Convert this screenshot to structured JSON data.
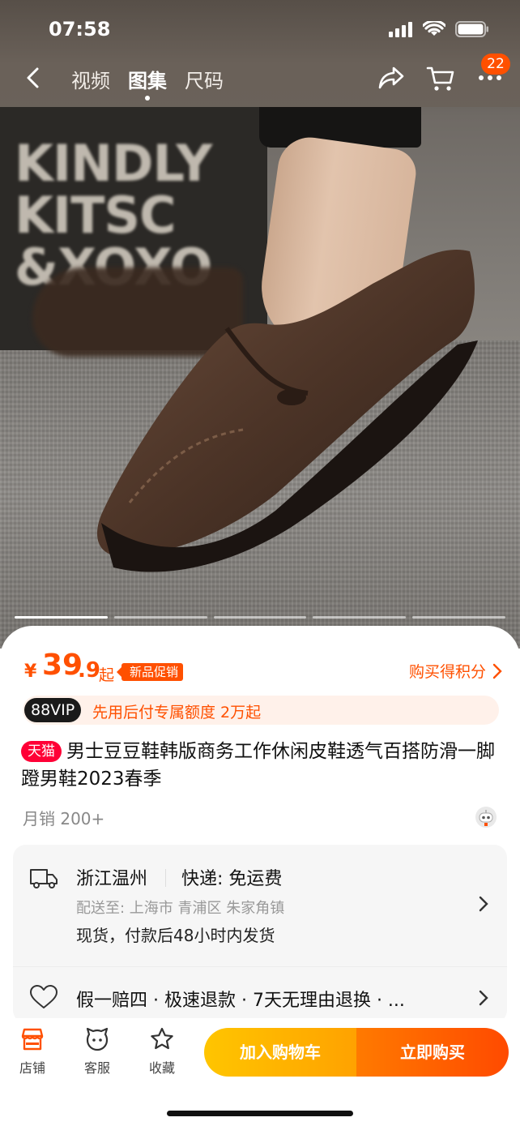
{
  "status_bar": {
    "time": "07:58"
  },
  "nav": {
    "tabs": [
      {
        "label": "视频",
        "active": false
      },
      {
        "label": "图集",
        "active": true
      },
      {
        "label": "尺码",
        "active": false
      }
    ],
    "cart_badge": "22",
    "icons": [
      "back-icon",
      "share-icon",
      "cart-icon",
      "more-icon"
    ]
  },
  "hero": {
    "background_text": "KINDLY\nKITSC\n&XOXO"
  },
  "carousel": {
    "pages": 5,
    "current": 1
  },
  "price": {
    "currency": "¥",
    "integer": "39",
    "decimal": ".9",
    "suffix": "起",
    "promo_tag": "新品促销",
    "points_link": "购买得积分"
  },
  "vip": {
    "badge": "88VIP",
    "text": "先用后付专属额度 2万起"
  },
  "product": {
    "store_tag": "天猫",
    "title": "男士豆豆鞋韩版商务工作休闲皮鞋透气百搭防滑一脚蹬男鞋2023春季",
    "monthly_sales": "月销 200+"
  },
  "delivery": {
    "origin": "浙江温州",
    "express": "快递: 免运费",
    "ship_to": "配送至: 上海市 青浦区 朱家角镇",
    "stock": "现货，付款后48小时内发货"
  },
  "service": {
    "text": "假一赔四 · 极速退款 · 7天无理由退换 · ..."
  },
  "bottom_bar": {
    "tools": [
      {
        "label": "店铺",
        "icon": "store-icon"
      },
      {
        "label": "客服",
        "icon": "customer-service-icon"
      },
      {
        "label": "收藏",
        "icon": "star-icon"
      }
    ],
    "add_to_cart": "加入购物车",
    "buy_now": "立即购买"
  },
  "colors": {
    "accent": "#ff5000",
    "tmall": "#ff0036",
    "cart_button": "#ffb400",
    "buy_button": "#ff5a00"
  }
}
